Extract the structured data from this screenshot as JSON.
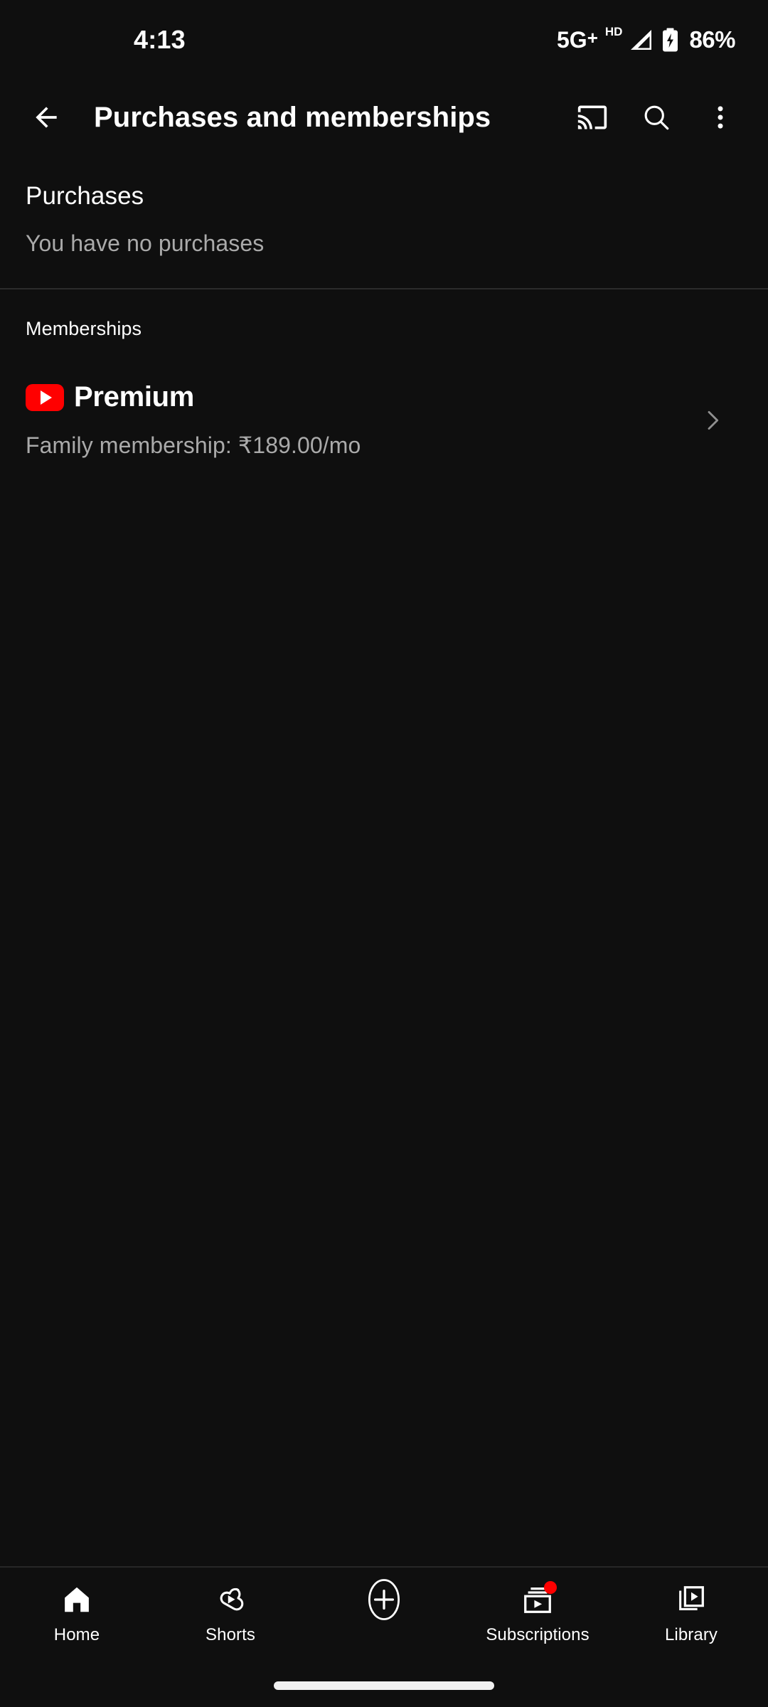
{
  "theme": {
    "background": "#0f0f0f",
    "text_primary": "#ffffff",
    "text_secondary": "#aaaaaa",
    "accent_red": "#ff0000",
    "divider": "#2c2c2c"
  },
  "status_bar": {
    "time": "4:13",
    "network_type": "5G",
    "network_plus": "+",
    "hd_indicator": "HD",
    "signal_icon": "signal-bars-icon",
    "battery_icon": "battery-charging-icon",
    "battery_percent": "86%"
  },
  "app_bar": {
    "back_icon": "back-arrow-icon",
    "title": "Purchases and memberships",
    "cast_icon": "cast-icon",
    "search_icon": "search-icon",
    "overflow_icon": "more-vert-icon"
  },
  "purchases": {
    "heading": "Purchases",
    "empty_message": "You have no purchases"
  },
  "memberships": {
    "heading": "Memberships",
    "items": [
      {
        "logo_icon": "youtube-play-logo-icon",
        "product": "Premium",
        "detail": "Family membership: ₹189.00/mo",
        "chevron_icon": "chevron-right-icon"
      }
    ]
  },
  "bottom_nav": {
    "items": [
      {
        "label": "Home",
        "icon": "home-icon",
        "badge": false
      },
      {
        "label": "Shorts",
        "icon": "shorts-icon",
        "badge": false
      },
      {
        "label": "",
        "icon": "create-plus-icon",
        "badge": false
      },
      {
        "label": "Subscriptions",
        "icon": "subscriptions-icon",
        "badge": true
      },
      {
        "label": "Library",
        "icon": "library-icon",
        "badge": false
      }
    ]
  },
  "system": {
    "home_indicator": "home-indicator-bar"
  }
}
